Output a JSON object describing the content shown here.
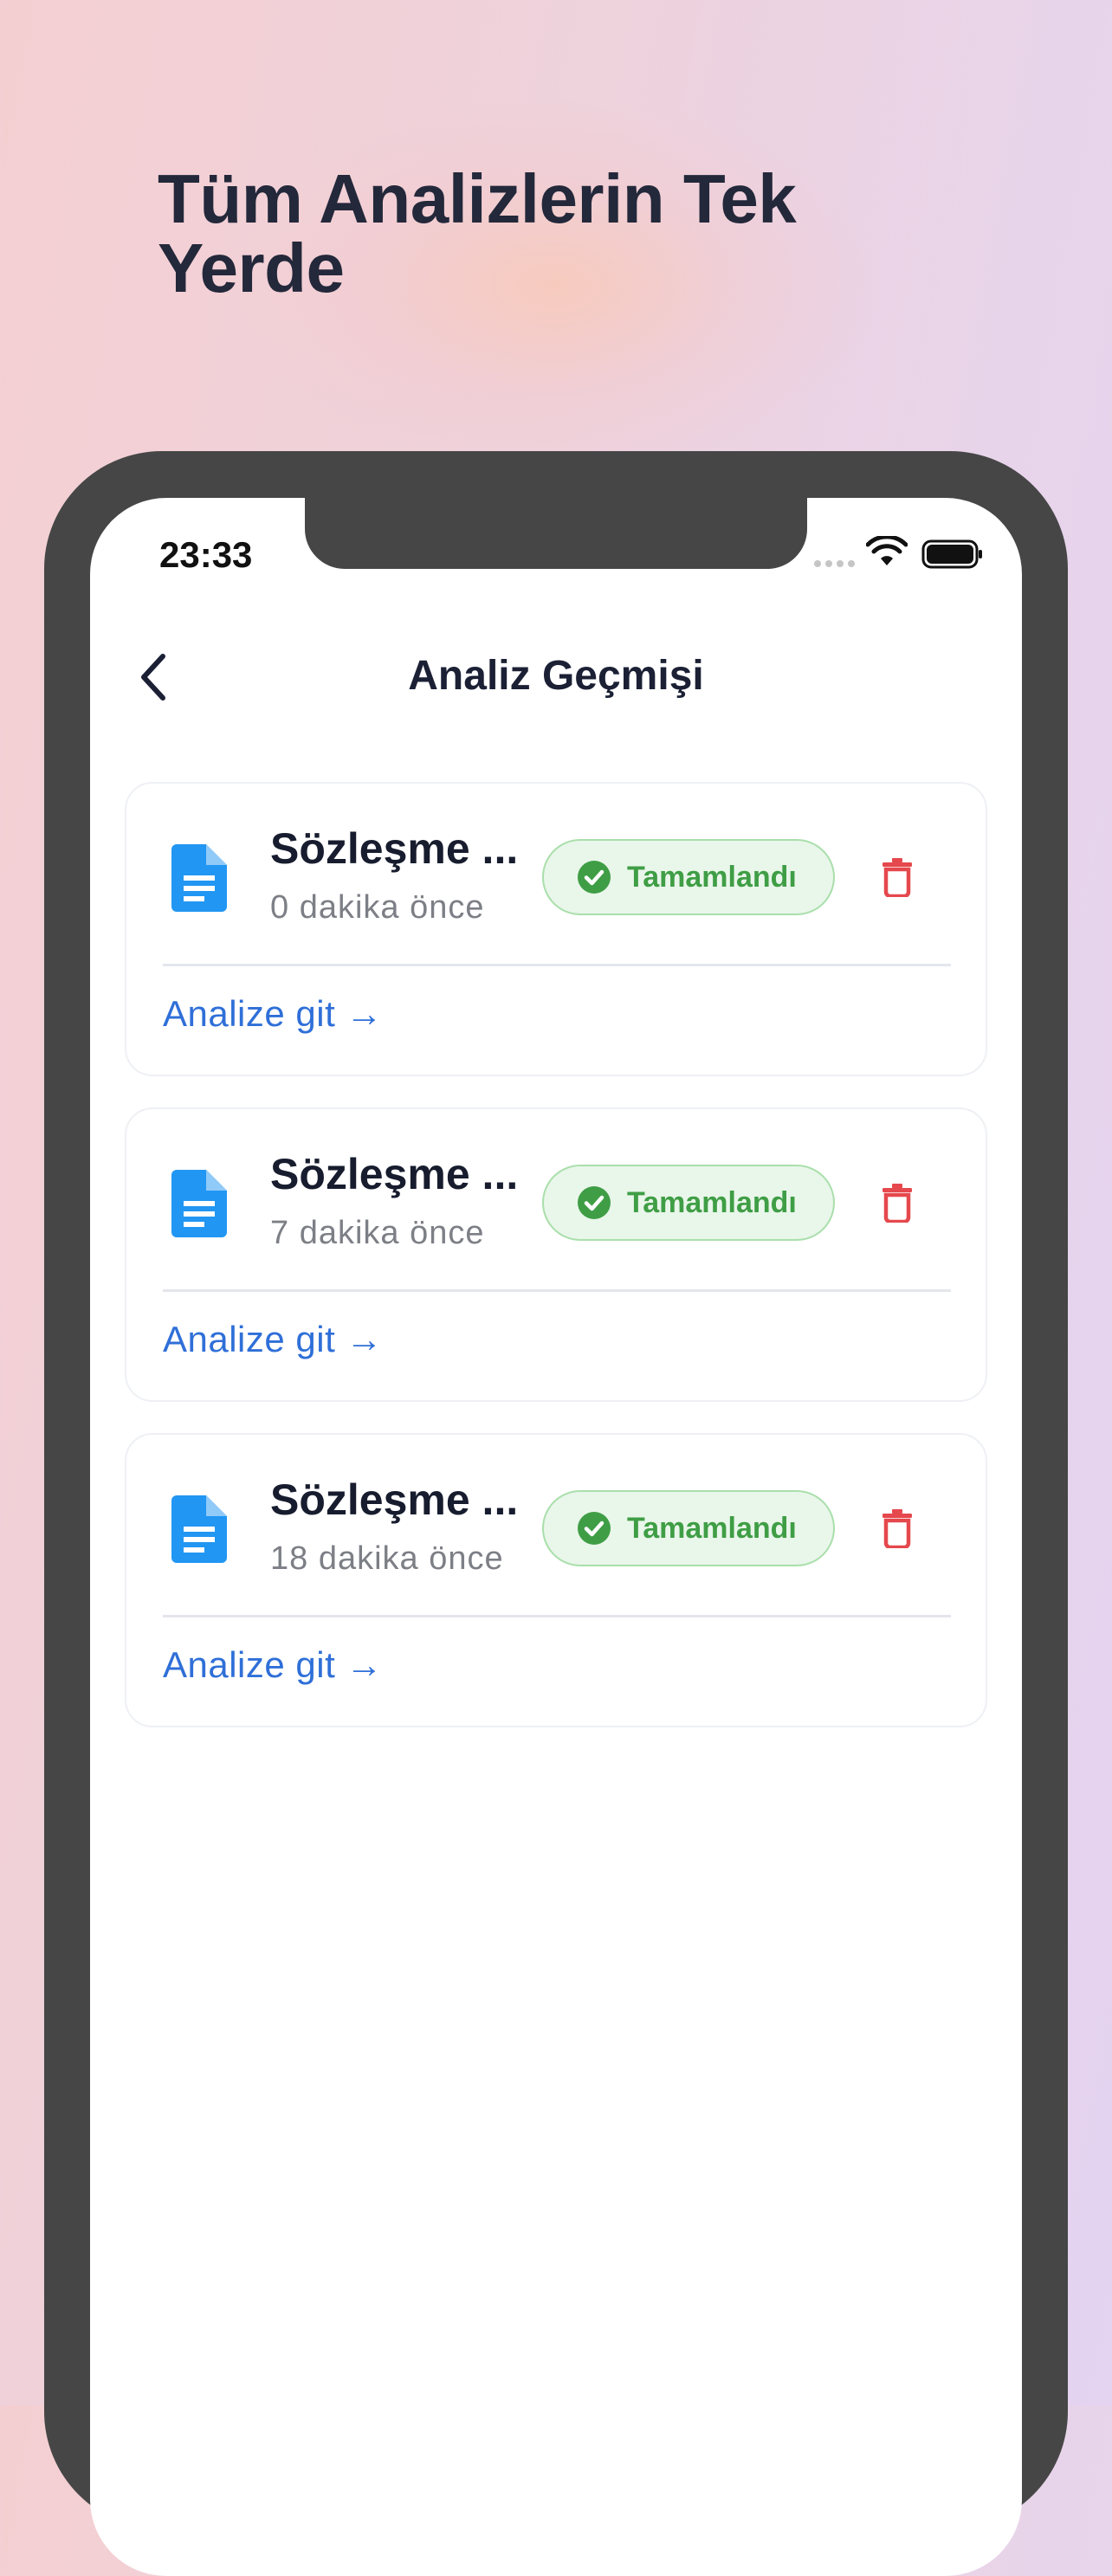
{
  "headline": "Tüm Analizlerin Tek Yerde",
  "status_bar": {
    "time": "23:33"
  },
  "nav": {
    "title": "Analiz Geçmişi",
    "back_icon": "chevron-left-icon"
  },
  "history": [
    {
      "title": "Sözleşme ...",
      "time": "0 dakika önce",
      "status": "Tamamlandı",
      "link": "Analize git →"
    },
    {
      "title": "Sözleşme ...",
      "time": "7 dakika önce",
      "status": "Tamamlandı",
      "link": "Analize git →"
    },
    {
      "title": "Sözleşme ...",
      "time": "18 dakika önce",
      "status": "Tamamlandı",
      "link": "Analize git →"
    }
  ],
  "colors": {
    "accent": "#2f6fd8",
    "document_icon": "#2196f3",
    "success": "#3f9e45",
    "success_bg": "#e9f6ea",
    "danger": "#e5484d",
    "phone_frame": "#464646"
  }
}
